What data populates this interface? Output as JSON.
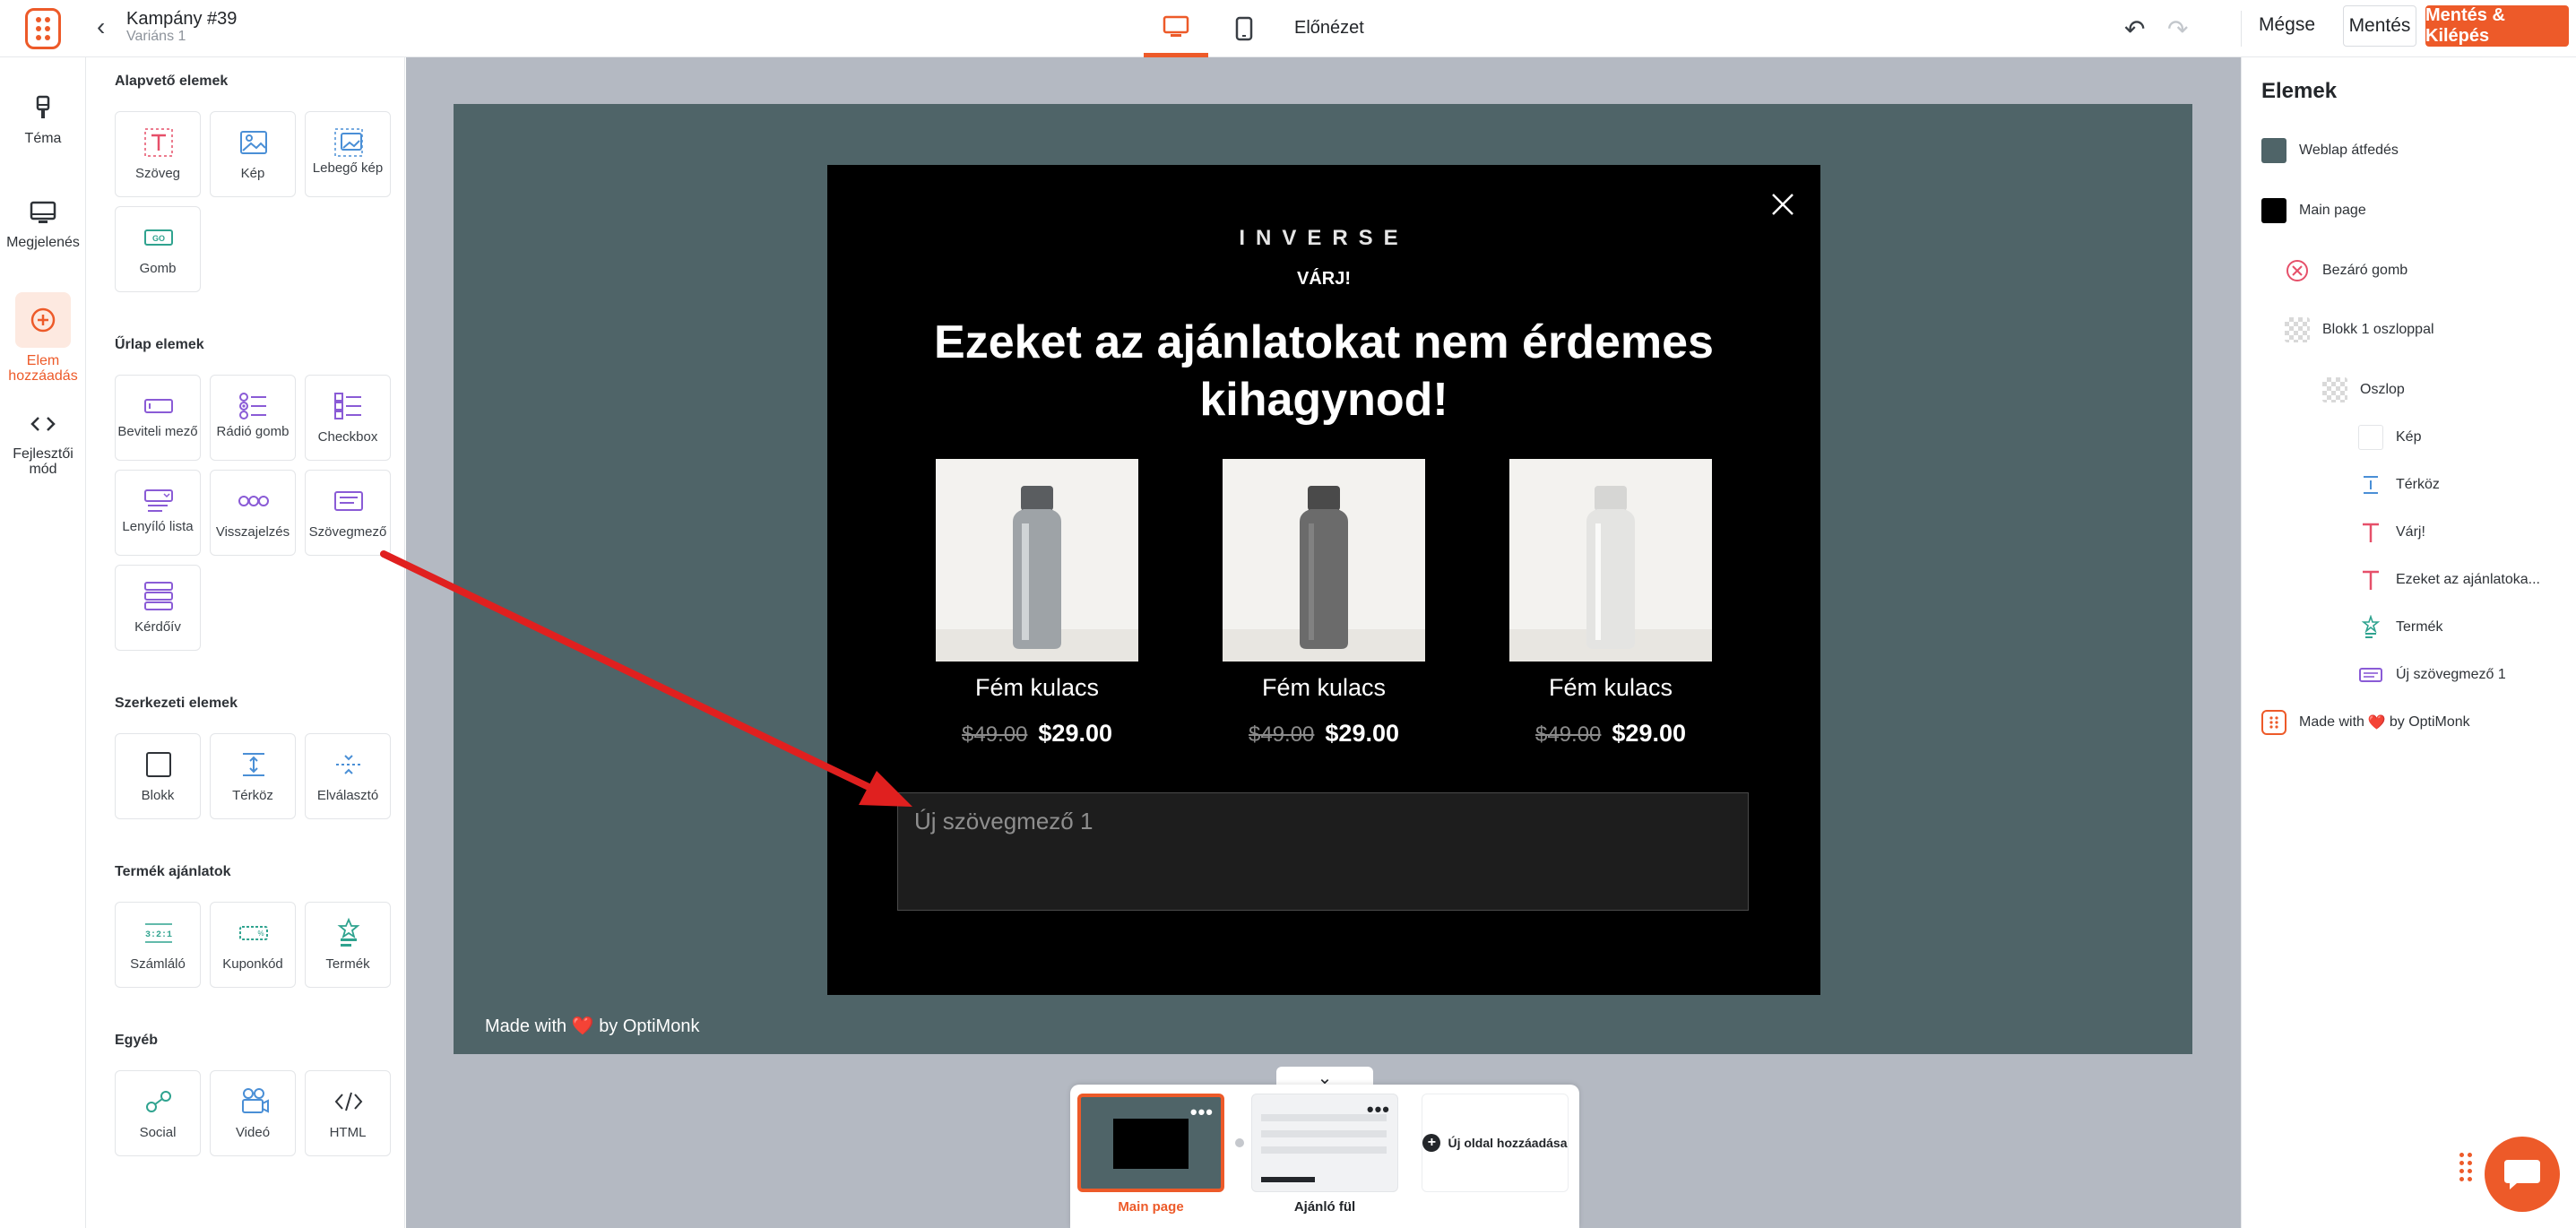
{
  "header": {
    "campaign_title": "Kampány #39",
    "variant": "Variáns 1",
    "preview_label": "Előnézet",
    "cancel_label": "Mégse",
    "save_label": "Mentés",
    "save_exit_label": "Mentés & Kilépés"
  },
  "rail": {
    "items": [
      {
        "label": "Téma",
        "icon": "brush-icon"
      },
      {
        "label": "Megjelenés",
        "icon": "monitor-icon"
      },
      {
        "label": "Elem hozzáadás",
        "icon": "plus-circle-icon",
        "active": true
      },
      {
        "label": "Fejlesztői mód",
        "icon": "code-icon"
      }
    ]
  },
  "panel": {
    "sections": {
      "basic": "Alapvető elemek",
      "form": "Űrlap elemek",
      "structure": "Szerkezeti elemek",
      "product": "Termék ajánlatok",
      "other": "Egyéb"
    },
    "basic_tiles": [
      "Szöveg",
      "Kép",
      "Lebegő kép",
      "Gomb"
    ],
    "form_tiles": [
      "Beviteli mező",
      "Rádió gomb",
      "Checkbox",
      "Lenyíló lista",
      "Visszajelzés",
      "Szövegmező",
      "Kérdőív"
    ],
    "structure_tiles": [
      "Blokk",
      "Térköz",
      "Elválasztó"
    ],
    "product_tiles": [
      "Számláló",
      "Kuponkód",
      "Termék"
    ],
    "other_tiles": [
      "Social",
      "Videó",
      "HTML"
    ],
    "button_icon_text": "GO",
    "counter_icon_text": "3:2:1"
  },
  "popup": {
    "brand": "INVERSE",
    "kicker": "VÁRJ!",
    "headline": "Ezeket az ajánlatokat nem érdemes kihagynod!",
    "products": [
      {
        "name": "Fém kulacs",
        "old_price": "$49.00",
        "price": "$29.00",
        "bottle_color": "#9ea3a7"
      },
      {
        "name": "Fém kulacs",
        "old_price": "$49.00",
        "price": "$29.00",
        "bottle_color": "#6b6b6b"
      },
      {
        "name": "Fém kulacs",
        "old_price": "$49.00",
        "price": "$29.00",
        "bottle_color": "#e4e4e2"
      }
    ],
    "textarea_placeholder": "Új szövegmező 1",
    "made_with_prefix": "Made with",
    "made_with_suffix": "by OptiMonk"
  },
  "pages": {
    "items": [
      {
        "label": "Main page",
        "active": true
      },
      {
        "label": "Ajánló fül",
        "active": false
      }
    ],
    "add_label": "Új oldal hozzáadása"
  },
  "layers": {
    "title": "Elemek",
    "items": [
      {
        "label": "Weblap átfedés"
      },
      {
        "label": "Main page"
      },
      {
        "label": "Bezáró gomb"
      },
      {
        "label": "Blokk 1 oszloppal"
      },
      {
        "label": "Oszlop"
      },
      {
        "label": "Kép"
      },
      {
        "label": "Térköz"
      },
      {
        "label": "Várj!"
      },
      {
        "label": "Ezeket az ajánlatoka..."
      },
      {
        "label": "Termék"
      },
      {
        "label": "Új szövegmező 1"
      },
      {
        "label_prefix": "Made with",
        "label_suffix": "by OptiMonk"
      }
    ]
  },
  "colors": {
    "accent": "#ed5a29",
    "overlay": "#4f6468",
    "popup_bg": "#000000",
    "canvas_bg": "#b4b9c2",
    "arrow": "#e0201f"
  }
}
